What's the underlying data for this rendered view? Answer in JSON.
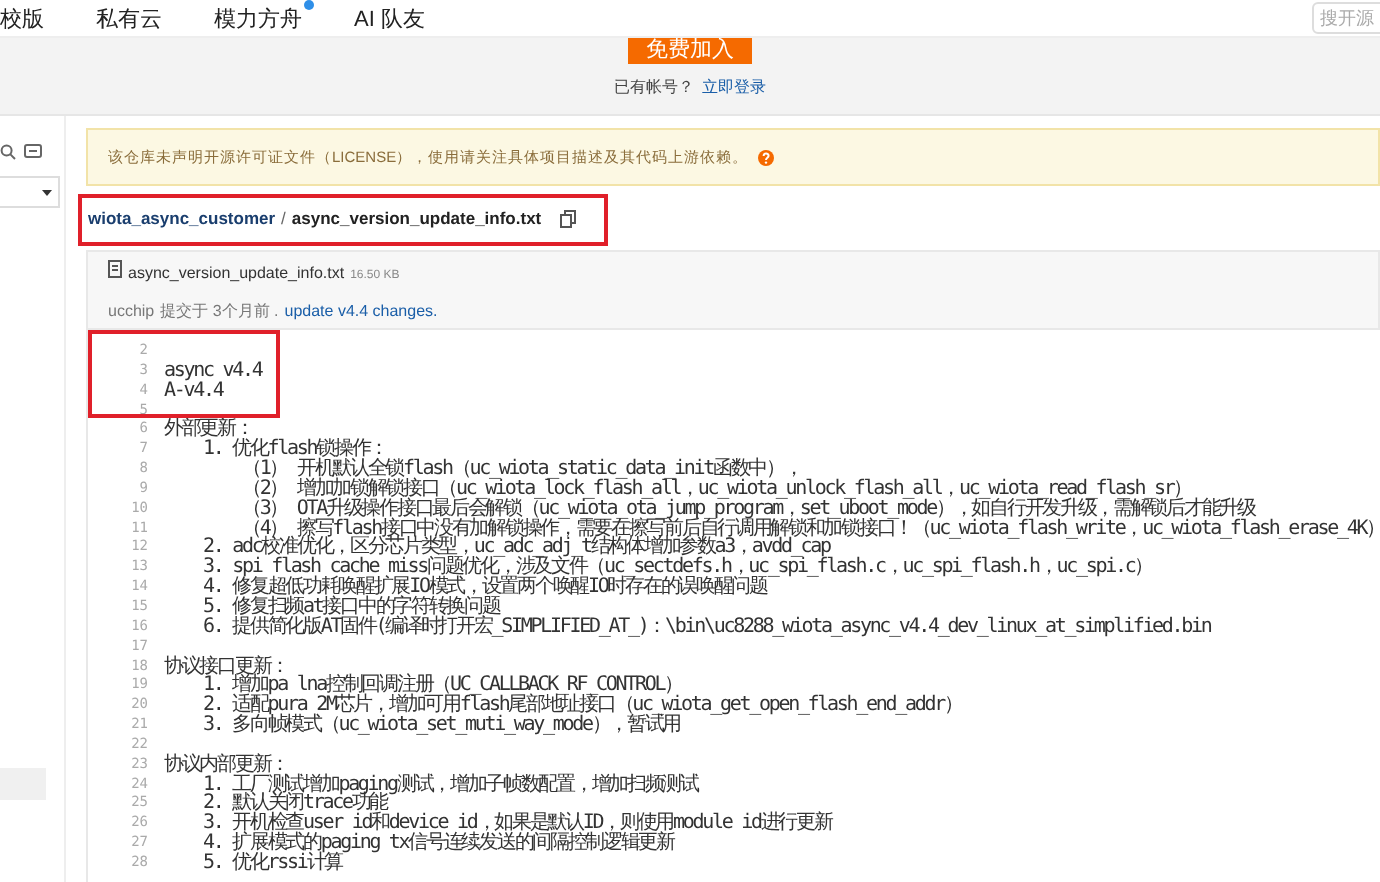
{
  "nav": {
    "items": [
      {
        "label": "校版",
        "badge": false
      },
      {
        "label": "私有云",
        "badge": false
      },
      {
        "label": "模力方舟",
        "badge": true
      },
      {
        "label": "AI 队友",
        "badge": false
      }
    ],
    "search": {
      "placeholder": "搜开源"
    }
  },
  "banner": {
    "join_button": "免费加入",
    "login_prompt": "已有帐号？",
    "login_link": "立即登录"
  },
  "notice": "该仓库未声明开源许可证文件（LICENSE），使用请关注具体项目描述及其代码上游依赖。",
  "breadcrumb": {
    "repo": "wiota_async_customer",
    "separator": "/",
    "file": "async_version_update_info.txt",
    "highlighted": true
  },
  "file": {
    "name": "async_version_update_info.txt",
    "size": "16.50 KB",
    "author": "ucchip",
    "commit_info": "提交于 3个月前 .",
    "commit_message": "update v4.4 changes."
  },
  "code": {
    "lines": [
      {
        "number": "2",
        "highlighted": true
      },
      {
        "number": "3",
        "text": "async v4.4",
        "highlighted": true
      },
      {
        "number": "4",
        "text": "A-v4.4",
        "highlighted": true
      },
      {
        "number": "5"
      },
      {
        "number": "6",
        "text": "外部更新："
      },
      {
        "number": "7",
        "text": "    1. 优化flash锁操作："
      },
      {
        "number": "8",
        "text": "        （1） 开机默认全锁flash（uc_wiota_static_data_init函数中），"
      },
      {
        "number": "9",
        "text": "        （2） 增加加锁解锁接口（uc_wiota_lock_flash_all，uc_wiota_unlock_flash_all，uc_wiota_read_flash_sr）"
      },
      {
        "number": "10",
        "text": "        （3） OTA升级操作接口最后会解锁（uc_wiota_ota_jump_program，set_uboot_mode），如自行开发升级，需解锁后才能升级"
      },
      {
        "number": "11",
        "text": "        （4） 擦写flash接口中没有加解锁操作，需要在擦写前后自行调用解锁和加锁接口！（uc_wiota_flash_write，uc_wiota_flash_erase_4K）"
      },
      {
        "number": "12",
        "text": "    2. adc校准优化，区分芯片类型，uc_adc_adj_t结构体增加参数a3，avdd_cap"
      },
      {
        "number": "13",
        "text": "    3. spi flash cache miss问题优化，涉及文件（uc_sectdefs.h，uc_spi_flash.c，uc_spi_flash.h，uc_spi.c）"
      },
      {
        "number": "14",
        "text": "    4. 修复超低功耗唤醒扩展IO模式，设置两个唤醒IO时存在的误唤醒问题"
      },
      {
        "number": "15",
        "text": "    5. 修复扫频at接口中的字符转换问题"
      },
      {
        "number": "16",
        "text": "    6. 提供简化版AT固件(编译时打开宏_SIMPLIFIED_AT_)：\\bin\\uc8288_wiota_async_v4.4_dev_linux_at_simplified.bin"
      },
      {
        "number": "17"
      },
      {
        "number": "18",
        "text": "协议接口更新："
      },
      {
        "number": "19",
        "text": "    1. 增加pa lna控制回调注册（UC_CALLBACK_RF_CONTROL）"
      },
      {
        "number": "20",
        "text": "    2. 适配pura 2M芯片，增加可用flash尾部地址接口（uc_wiota_get_open_flash_end_addr）"
      },
      {
        "number": "21",
        "text": "    3. 多向帧模式（uc_wiota_set_muti_way_mode），暂试用"
      },
      {
        "number": "22"
      },
      {
        "number": "23",
        "text": "协议内部更新："
      },
      {
        "number": "24",
        "text": "    1. 工厂测试增加paging测试，增加子帧数配置，增加扫频测试"
      },
      {
        "number": "25",
        "text": "    2. 默认关闭trace功能"
      },
      {
        "number": "26",
        "text": "    3. 开机检查user id和device id，如果是默认ID，则使用module id进行更新"
      },
      {
        "number": "27",
        "text": "    4. 扩展模式的paging tx信号连续发送的间隔控制逻辑更新"
      },
      {
        "number": "28",
        "text": "    5. 优化rssi计算"
      }
    ]
  }
}
